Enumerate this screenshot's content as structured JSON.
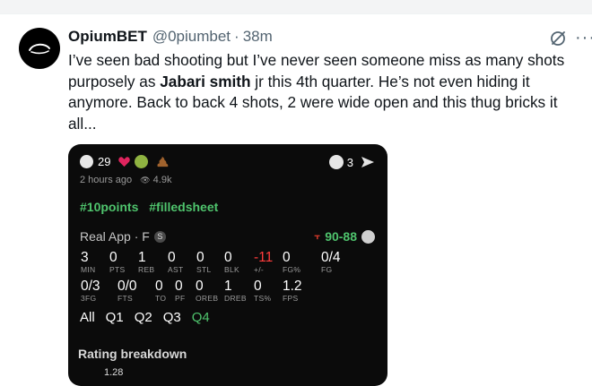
{
  "tweet": {
    "display_name": "OpiumBET",
    "handle": "@0piumbet",
    "separator": "·",
    "time": "38m",
    "text_before": "I’ve seen bad shooting but I’ve never seen someone miss as many shots purposely as ",
    "text_bold": "Jabari smith",
    "text_after": " jr this 4th quarter. He’s not even hiding it anymore. Back to back 4 shots, 2 were wide open and this thug bricks it all...",
    "more_label": "···"
  },
  "card": {
    "reaction_count": "29",
    "share_count": "3",
    "posted_ago": "2 hours ago",
    "views": "4.9k",
    "views_icon": "👁",
    "hashtags": [
      "#10points",
      "#filledsheet"
    ],
    "game_label": "Real App · F",
    "game_badge": "S",
    "score_mark": "⫟",
    "score": "90-88",
    "stats_row1": [
      {
        "value": "3",
        "label": "MIN"
      },
      {
        "value": "0",
        "label": "PTS"
      },
      {
        "value": "1",
        "label": "REB"
      },
      {
        "value": "0",
        "label": "AST"
      },
      {
        "value": "0",
        "label": "STL"
      },
      {
        "value": "0",
        "label": "BLK"
      },
      {
        "value": "-11",
        "label": "+/-"
      },
      {
        "value": "0",
        "label": "FG%"
      },
      {
        "value": "0/4",
        "label": "FG"
      }
    ],
    "stats_row2": [
      {
        "value": "0/3",
        "label": "3FG"
      },
      {
        "value": "0/0",
        "label": "FTS"
      },
      {
        "value": "0",
        "label": "TO"
      },
      {
        "value": "0",
        "label": "PF"
      },
      {
        "value": "0",
        "label": "OREB"
      },
      {
        "value": "1",
        "label": "DREB"
      },
      {
        "value": "0",
        "label": "TS%"
      },
      {
        "value": "1.2",
        "label": "FPS"
      }
    ],
    "periods": [
      "All",
      "Q1",
      "Q2",
      "Q3",
      "Q4"
    ],
    "active_period": "Q4",
    "rating_title": "Rating breakdown",
    "rating_value": "1.28"
  },
  "colors": {
    "accent_green": "#4fc46d",
    "negative_red": "#ff3b3b",
    "card_bg": "#0b0b0b"
  },
  "icons": {
    "grok": "grok-icon",
    "share": "send-icon",
    "heart": "heart-icon"
  }
}
